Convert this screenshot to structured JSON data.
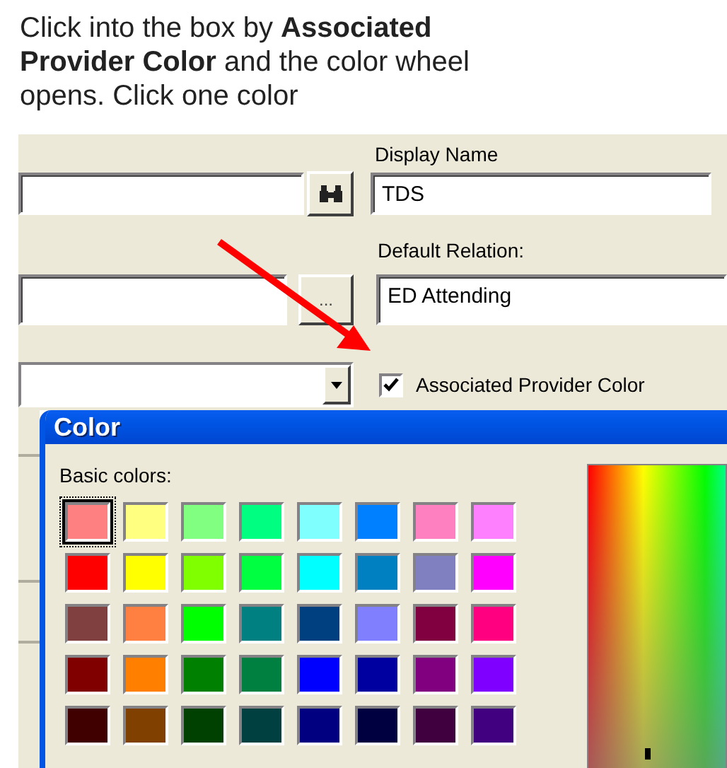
{
  "instruction": "Click into the box by **Associated Provider Color** and the color wheel opens. Click one color",
  "form": {
    "display_name": {
      "label": "Display Name",
      "value": "TDS"
    },
    "default_relation": {
      "label": "Default Relation:",
      "value": "ED Attending"
    },
    "browse_button": "...",
    "associated_color": {
      "label": "Associated Provider Color",
      "checked": true
    }
  },
  "color_dialog": {
    "title": "Color",
    "basic_colors_label": "Basic colors:",
    "swatches": [
      {
        "color": "#ff8080",
        "selected": true
      },
      {
        "color": "#ffff80",
        "selected": false
      },
      {
        "color": "#80ff80",
        "selected": false
      },
      {
        "color": "#00ff80",
        "selected": false
      },
      {
        "color": "#80ffff",
        "selected": false
      },
      {
        "color": "#0080ff",
        "selected": false
      },
      {
        "color": "#ff80c0",
        "selected": false
      },
      {
        "color": "#ff80ff",
        "selected": false
      },
      {
        "color": "#ff0000",
        "selected": false
      },
      {
        "color": "#ffff00",
        "selected": false
      },
      {
        "color": "#80ff00",
        "selected": false
      },
      {
        "color": "#00ff40",
        "selected": false
      },
      {
        "color": "#00ffff",
        "selected": false
      },
      {
        "color": "#0080c0",
        "selected": false
      },
      {
        "color": "#8080c0",
        "selected": false
      },
      {
        "color": "#ff00ff",
        "selected": false
      },
      {
        "color": "#804040",
        "selected": false
      },
      {
        "color": "#ff8040",
        "selected": false
      },
      {
        "color": "#00ff00",
        "selected": false
      },
      {
        "color": "#008080",
        "selected": false
      },
      {
        "color": "#004080",
        "selected": false
      },
      {
        "color": "#8080ff",
        "selected": false
      },
      {
        "color": "#800040",
        "selected": false
      },
      {
        "color": "#ff0080",
        "selected": false
      },
      {
        "color": "#800000",
        "selected": false
      },
      {
        "color": "#ff8000",
        "selected": false
      },
      {
        "color": "#008000",
        "selected": false
      },
      {
        "color": "#008040",
        "selected": false
      },
      {
        "color": "#0000ff",
        "selected": false
      },
      {
        "color": "#0000a0",
        "selected": false
      },
      {
        "color": "#800080",
        "selected": false
      },
      {
        "color": "#8000ff",
        "selected": false
      },
      {
        "color": "#400000",
        "selected": false
      },
      {
        "color": "#804000",
        "selected": false
      },
      {
        "color": "#004000",
        "selected": false
      },
      {
        "color": "#004040",
        "selected": false
      },
      {
        "color": "#000080",
        "selected": false
      },
      {
        "color": "#000040",
        "selected": false
      },
      {
        "color": "#400040",
        "selected": false
      },
      {
        "color": "#400080",
        "selected": false
      }
    ]
  }
}
